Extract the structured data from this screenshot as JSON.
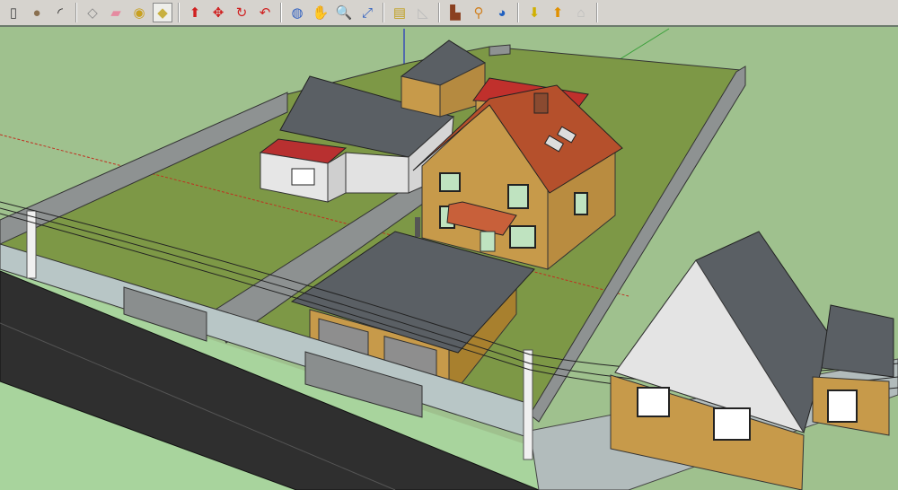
{
  "toolbar": {
    "groups": [
      [
        {
          "icon": "rectangle-icon",
          "glyph": "▯",
          "color": "#444444"
        },
        {
          "icon": "circle-icon",
          "glyph": "●",
          "color": "#8a7050"
        },
        {
          "icon": "arc-icon",
          "glyph": "◜",
          "color": "#222222"
        }
      ],
      [
        {
          "icon": "make-component-icon",
          "glyph": "◇",
          "color": "#888888"
        },
        {
          "icon": "eraser-icon",
          "glyph": "▰",
          "color": "#e58aa0"
        },
        {
          "icon": "tape-measure-icon",
          "glyph": "◉",
          "color": "#c8a020"
        },
        {
          "icon": "paint-bucket-icon",
          "glyph": "◆",
          "color": "#c8b040",
          "active": true
        }
      ],
      [
        {
          "icon": "push-pull-icon",
          "glyph": "⬆",
          "color": "#d02020"
        },
        {
          "icon": "move-icon",
          "glyph": "✥",
          "color": "#d02020"
        },
        {
          "icon": "rotate-icon",
          "glyph": "↻",
          "color": "#d02020"
        },
        {
          "icon": "offset-icon",
          "glyph": "↶",
          "color": "#d02020"
        }
      ],
      [
        {
          "icon": "orbit-icon",
          "glyph": "◍",
          "color": "#3060c0"
        },
        {
          "icon": "pan-hand-icon",
          "glyph": "✋",
          "color": "#666666"
        },
        {
          "icon": "zoom-icon",
          "glyph": "🔍",
          "color": "#2040a0"
        },
        {
          "icon": "zoom-extents-icon",
          "glyph": "⤢",
          "color": "#3060c0"
        }
      ],
      [
        {
          "icon": "get-current-view-icon",
          "glyph": "▤",
          "color": "#c0a020"
        },
        {
          "icon": "toggle-terrain-icon",
          "glyph": "◺",
          "color": "#bbbbbb"
        }
      ],
      [
        {
          "icon": "add-location-icon",
          "glyph": "▙",
          "color": "#8a4020"
        },
        {
          "icon": "place-model-icon",
          "glyph": "⚲",
          "color": "#d08020"
        },
        {
          "icon": "google-earth-icon",
          "glyph": "◕",
          "color": "#2060c0"
        }
      ],
      [
        {
          "icon": "get-models-icon",
          "glyph": "⬇",
          "color": "#d0b000"
        },
        {
          "icon": "share-model-icon",
          "glyph": "⬆",
          "color": "#e09000"
        },
        {
          "icon": "share-component-icon",
          "glyph": "⌂",
          "color": "#bbbbbb"
        }
      ]
    ]
  },
  "scene": {
    "colors": {
      "ground": "#9fc18e",
      "lawn": "#7d9846",
      "road": "#303030",
      "wall_grey": "#8e9292",
      "brick": "#c79a4a",
      "roof_red": "#b5502c",
      "roof_grey": "#5a5f64",
      "siding": "#e2e2e2"
    }
  }
}
